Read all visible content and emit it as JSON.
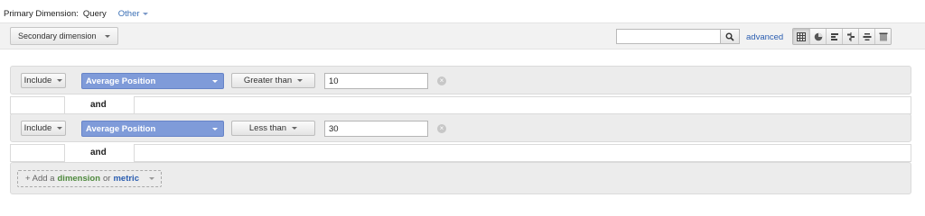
{
  "primary": {
    "label": "Primary Dimension:",
    "selected": "Query",
    "other": "Other"
  },
  "toolbar": {
    "secondary_dimension": "Secondary dimension",
    "search_value": "",
    "advanced": "advanced",
    "view_icons": [
      "table-view-icon",
      "pie-view-icon",
      "performance-view-icon",
      "comparison-view-icon",
      "term-cloud-view-icon",
      "pivot-view-icon"
    ]
  },
  "filters": [
    {
      "include": "Include",
      "metric": "Average Position",
      "comparison": "Greater than",
      "value": "10"
    },
    {
      "include": "Include",
      "metric": "Average Position",
      "comparison": "Less than",
      "value": "30"
    }
  ],
  "and_label": "and",
  "add": {
    "prefix": "+ Add a",
    "dimension": "dimension",
    "or": "or",
    "metric": "metric"
  },
  "colors": {
    "metric_button": "#7f9bd9",
    "link": "#2a5db0",
    "dimension_green": "#4f8a3e"
  }
}
